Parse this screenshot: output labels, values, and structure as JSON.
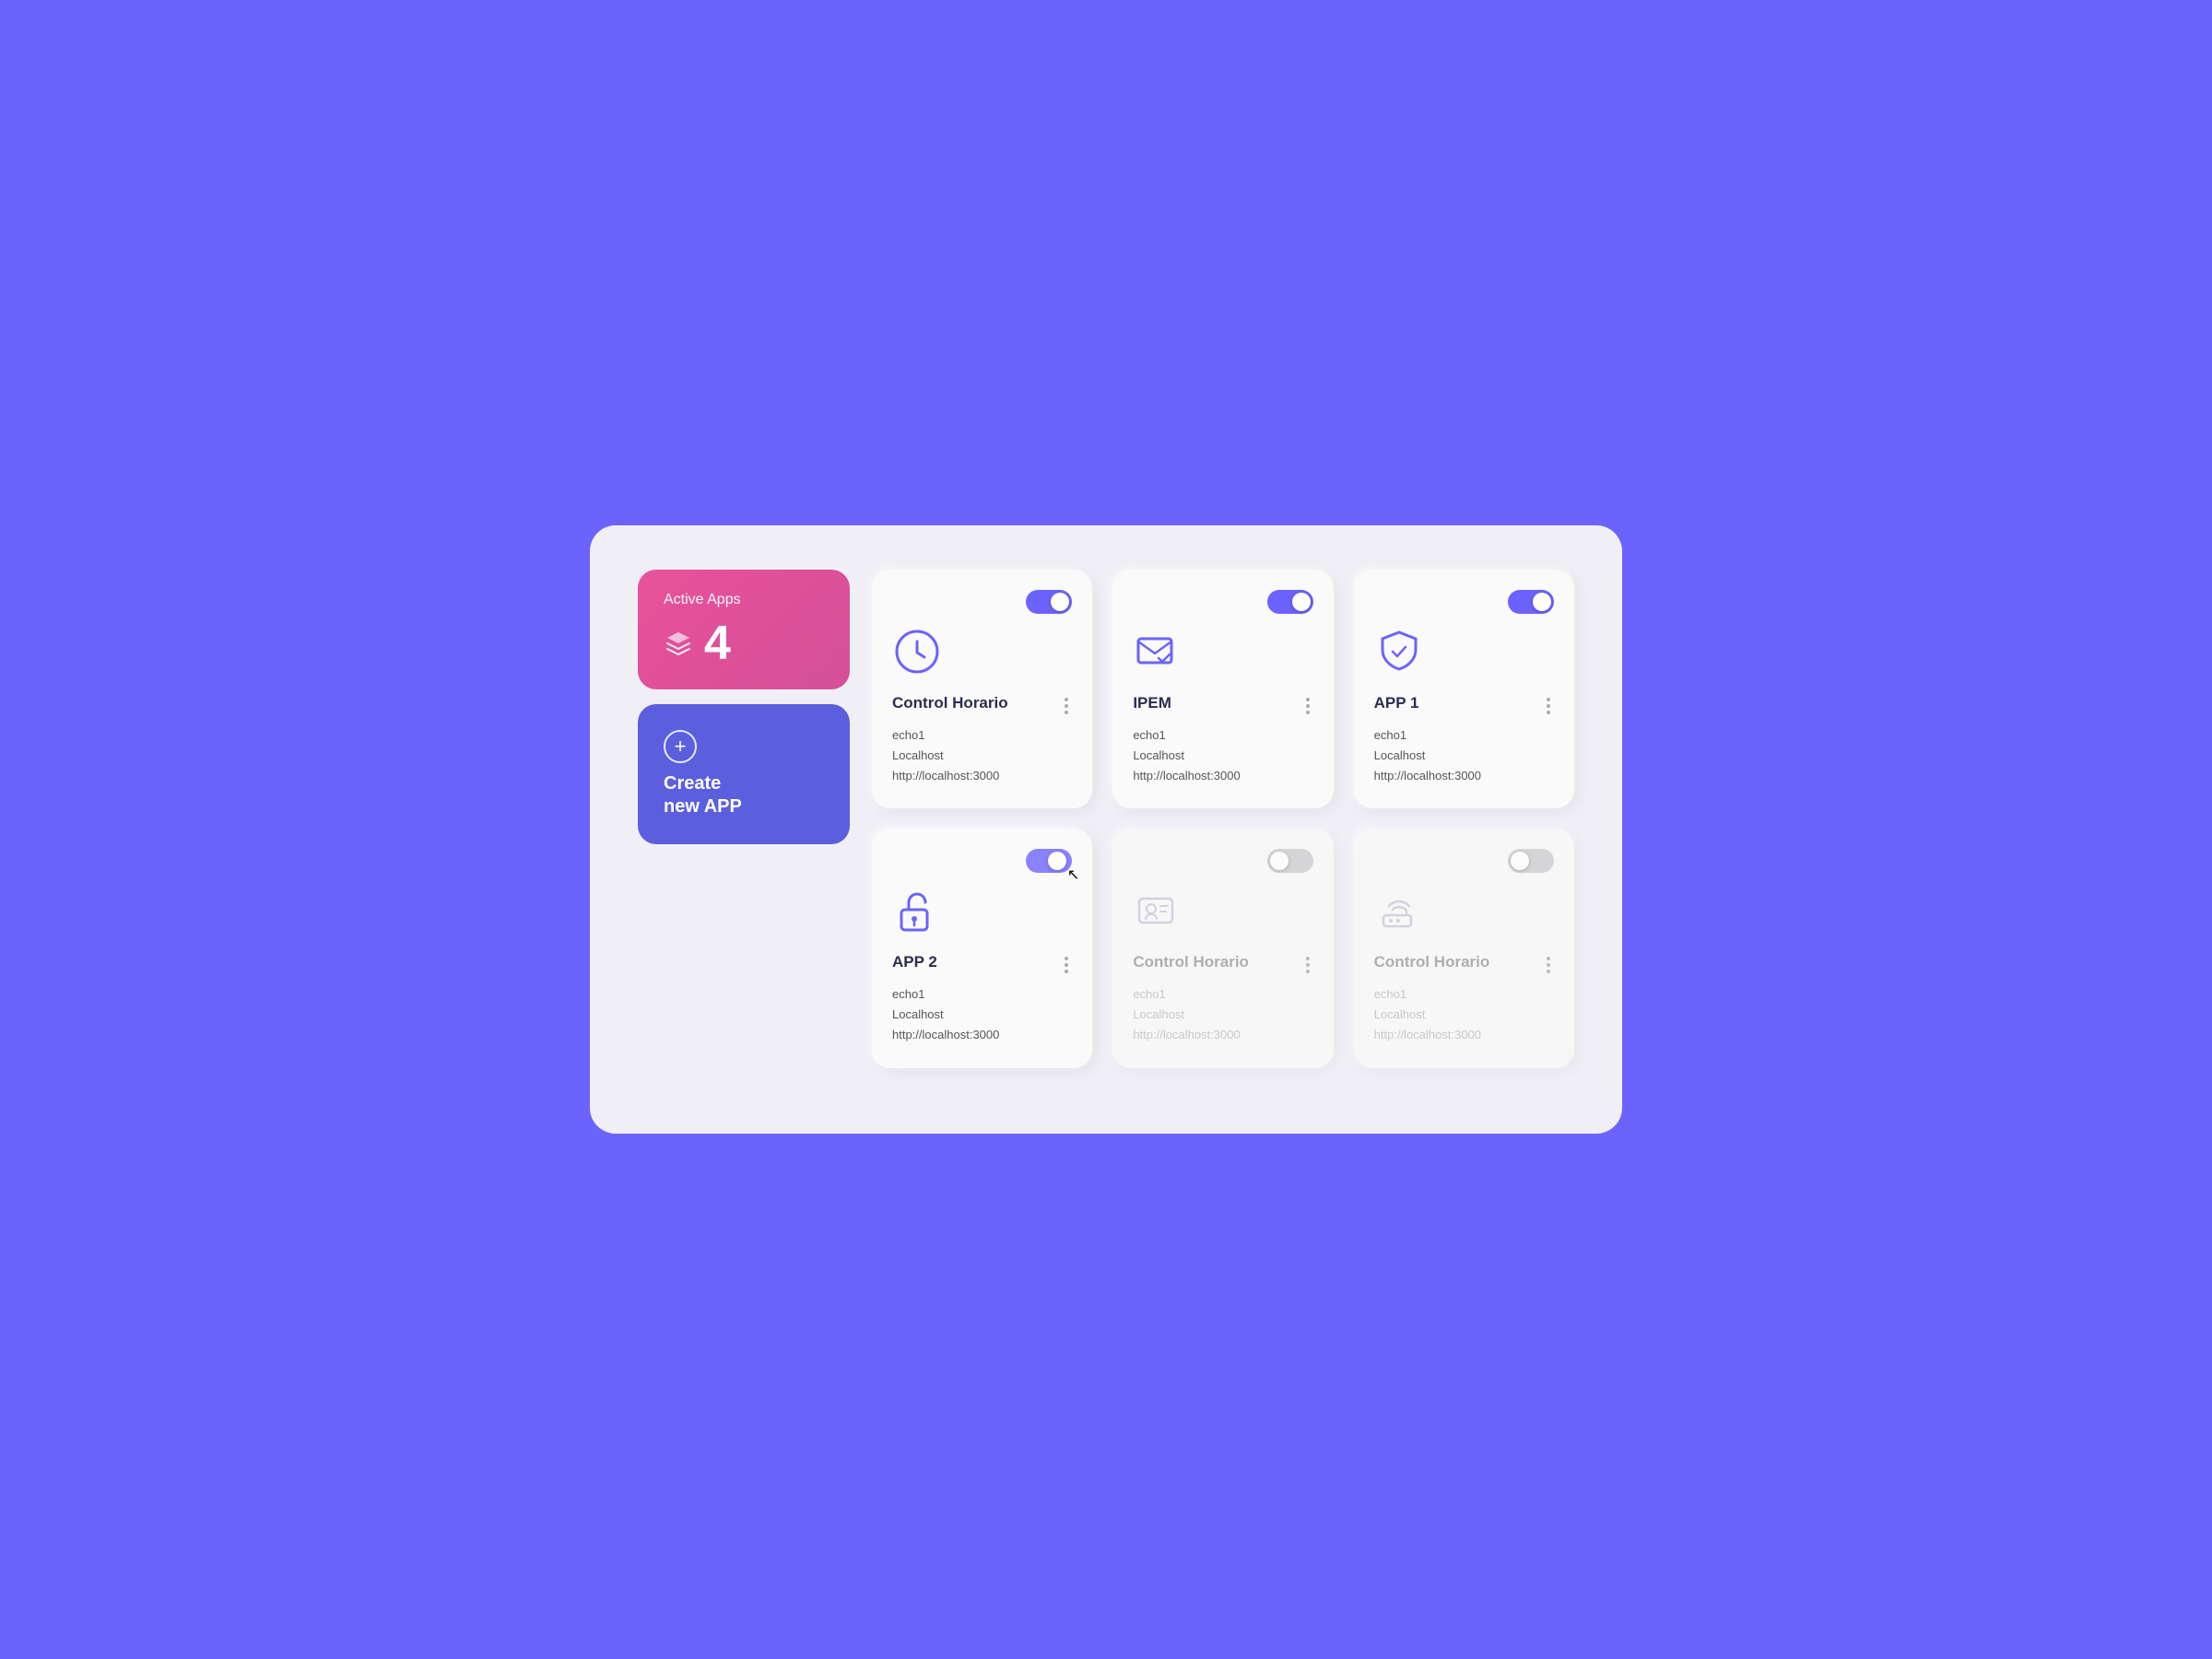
{
  "sidebar": {
    "active_apps_label": "Active Apps",
    "active_apps_count": "4",
    "create_new_label": "Create\nnew APP"
  },
  "apps": {
    "row1": [
      {
        "id": "control-horario",
        "name": "Control Horario",
        "icon": "clock",
        "active": true,
        "echo": "echo1",
        "host": "Localhost",
        "url": "http://localhost:3000"
      },
      {
        "id": "ipem",
        "name": "IPEM",
        "icon": "mail-check",
        "active": true,
        "echo": "echo1",
        "host": "Localhost",
        "url": "http://localhost:3000"
      },
      {
        "id": "app1",
        "name": "APP 1",
        "icon": "shield-check",
        "active": true,
        "echo": "echo1",
        "host": "Localhost",
        "url": "http://localhost:3000"
      }
    ],
    "row2": [
      {
        "id": "app2",
        "name": "APP 2",
        "icon": "lock-open",
        "active": true,
        "toggling": true,
        "echo": "echo1",
        "host": "Localhost",
        "url": "http://localhost:3000"
      },
      {
        "id": "control-horario-2",
        "name": "Control Horario",
        "icon": "id-card",
        "active": false,
        "echo": "echo1",
        "host": "Localhost",
        "url": "http://localhost:3000"
      },
      {
        "id": "control-horario-3",
        "name": "Control Horario",
        "icon": "router",
        "active": false,
        "echo": "echo1",
        "host": "Localhost",
        "url": "http://localhost:3000"
      }
    ]
  },
  "colors": {
    "accent": "#6C63FF",
    "pink": "#E8529A",
    "inactive_icon": "#c8c8d8"
  }
}
